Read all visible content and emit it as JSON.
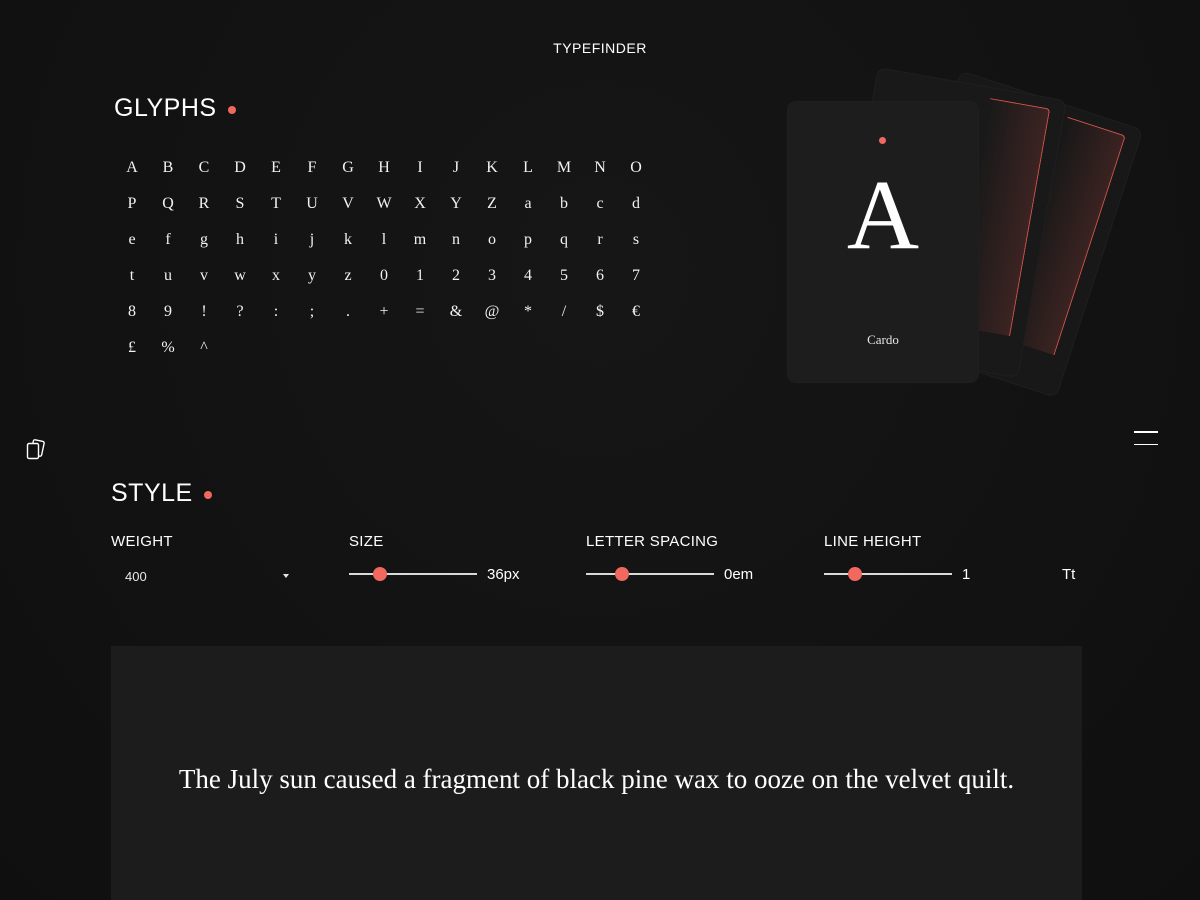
{
  "app": {
    "title": "TYPEFINDER"
  },
  "glyphs_section": {
    "heading": "GLYPHS",
    "characters": [
      "A",
      "B",
      "C",
      "D",
      "E",
      "F",
      "G",
      "H",
      "I",
      "J",
      "K",
      "L",
      "M",
      "N",
      "O",
      "P",
      "Q",
      "R",
      "S",
      "T",
      "U",
      "V",
      "W",
      "X",
      "Y",
      "Z",
      "a",
      "b",
      "c",
      "d",
      "e",
      "f",
      "g",
      "h",
      "i",
      "j",
      "k",
      "l",
      "m",
      "n",
      "o",
      "p",
      "q",
      "r",
      "s",
      "t",
      "u",
      "v",
      "w",
      "x",
      "y",
      "z",
      "0",
      "1",
      "2",
      "3",
      "4",
      "5",
      "6",
      "7",
      "8",
      "9",
      "!",
      "?",
      ":",
      ";",
      ".",
      "+",
      "=",
      "&",
      "@",
      "*",
      "/",
      "$",
      "€",
      "£",
      "%",
      "^"
    ]
  },
  "card": {
    "letter": "A",
    "font_name": "Cardo"
  },
  "style_section": {
    "heading": "STYLE",
    "weight": {
      "label": "WEIGHT",
      "value": "400"
    },
    "size": {
      "label": "SIZE",
      "value_text": "36px",
      "level": 0.24
    },
    "letter_spacing": {
      "label": "LETTER SPACING",
      "value_text": "0em",
      "level": 0.28
    },
    "line_height": {
      "label": "LINE HEIGHT",
      "value_text": "1",
      "level": 0.24
    },
    "case_toggle": "Tt"
  },
  "preview": {
    "text": "The July sun caused a fragment of black pine wax to ooze on the velvet quilt."
  },
  "icons": {
    "cards": "cards-icon",
    "menu": "menu-icon"
  },
  "colors": {
    "accent": "#f0685e",
    "background": "#121212",
    "panel": "#1c1c1c"
  }
}
